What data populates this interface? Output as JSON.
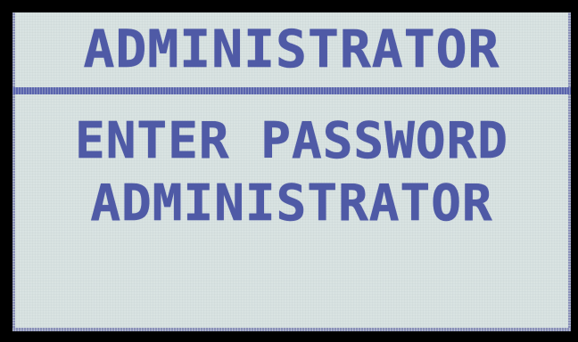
{
  "header": {
    "title": "ADMINISTRATOR"
  },
  "main": {
    "prompt_line1": "ENTER PASSWORD",
    "prompt_line2": "ADMINISTRATOR"
  },
  "colors": {
    "text": "#4f5aa6",
    "background": "#d9e3e2",
    "bezel": "#000000"
  }
}
